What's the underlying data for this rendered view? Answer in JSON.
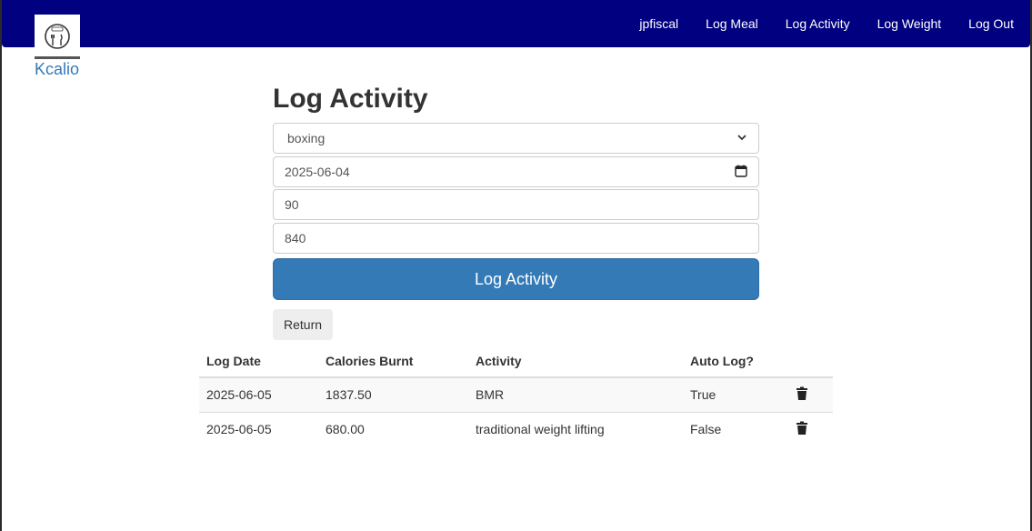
{
  "app": {
    "brand": "Kcalio"
  },
  "nav": {
    "username": "jpfiscal",
    "items": [
      "Log Meal",
      "Log Activity",
      "Log Weight",
      "Log Out"
    ]
  },
  "form": {
    "title": "Log Activity",
    "activity_selected": "boxing",
    "date_value": "2025-06-04",
    "duration_value": "90",
    "calories_value": "840",
    "submit_label": "Log Activity",
    "return_label": "Return"
  },
  "table": {
    "headers": [
      "Log Date",
      "Calories Burnt",
      "Activity",
      "Auto Log?"
    ],
    "rows": [
      {
        "date": "2025-06-05",
        "calories": "1837.50",
        "activity": "BMR",
        "auto": "True"
      },
      {
        "date": "2025-06-05",
        "calories": "680.00",
        "activity": "traditional weight lifting",
        "auto": "False"
      }
    ]
  },
  "colors": {
    "navbar": "#000080",
    "primary": "#337ab7",
    "brand_link": "#337ab7"
  },
  "icons": [
    "logo-icon",
    "chevron-down-icon",
    "calendar-icon",
    "trash-icon"
  ]
}
